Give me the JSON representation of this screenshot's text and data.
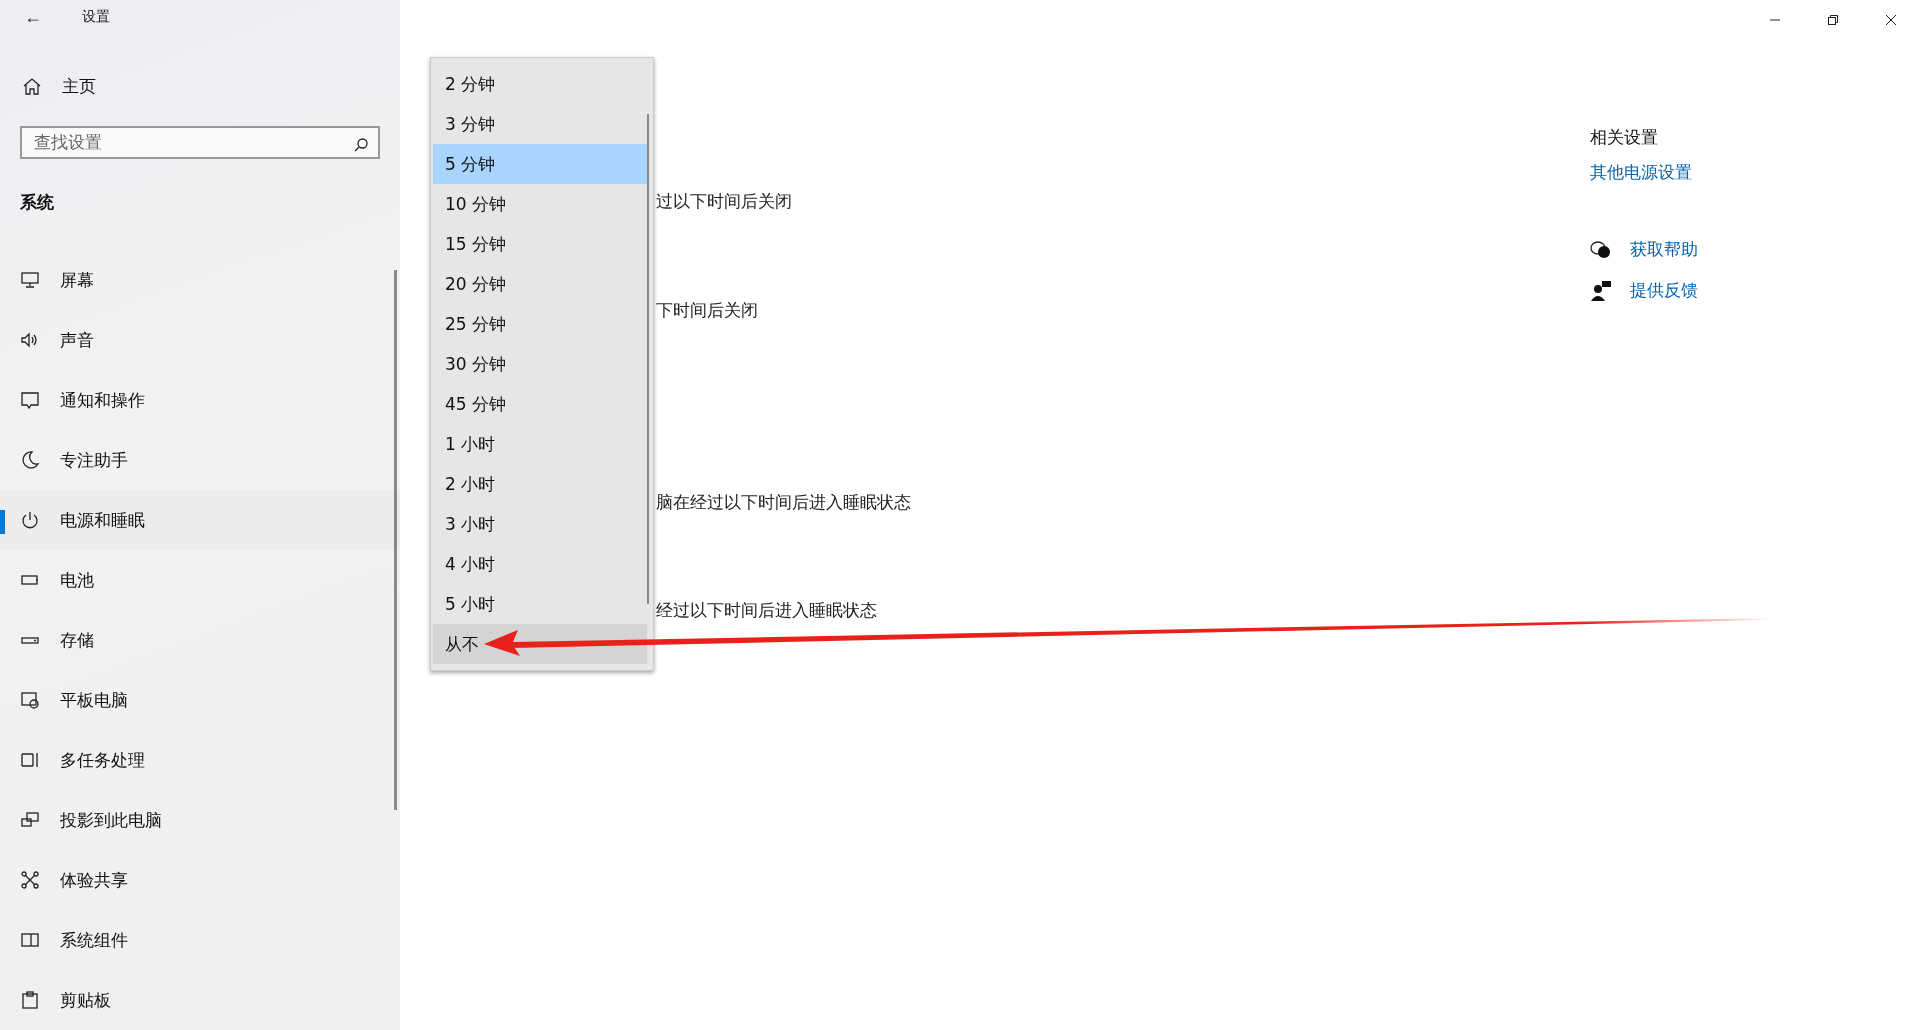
{
  "window": {
    "title": "设置",
    "back": "←"
  },
  "sidebar": {
    "home": "主页",
    "search": {
      "placeholder": "查找设置"
    },
    "section": "系统",
    "items": [
      {
        "label": "屏幕",
        "selected": false
      },
      {
        "label": "声音",
        "selected": false
      },
      {
        "label": "通知和操作",
        "selected": false
      },
      {
        "label": "专注助手",
        "selected": false
      },
      {
        "label": "电源和睡眠",
        "selected": true
      },
      {
        "label": "电池",
        "selected": false
      },
      {
        "label": "存储",
        "selected": false
      },
      {
        "label": "平板电脑",
        "selected": false
      },
      {
        "label": "多任务处理",
        "selected": false
      },
      {
        "label": "投影到此电脑",
        "selected": false
      },
      {
        "label": "体验共享",
        "selected": false
      },
      {
        "label": "系统组件",
        "selected": false
      },
      {
        "label": "剪贴板",
        "selected": false
      }
    ]
  },
  "main": {
    "lines": [
      {
        "text": "过以下时间后关闭"
      },
      {
        "text": "下时间后关闭"
      },
      {
        "text": "脑在经过以下时间后进入睡眠状态"
      },
      {
        "text": "经过以下时间后进入睡眠状态"
      }
    ]
  },
  "dropdown": {
    "options": [
      {
        "label": "2 分钟",
        "selected": false,
        "hovered": false
      },
      {
        "label": "3 分钟",
        "selected": false,
        "hovered": false
      },
      {
        "label": "5 分钟",
        "selected": true,
        "hovered": false
      },
      {
        "label": "10 分钟",
        "selected": false,
        "hovered": false
      },
      {
        "label": "15 分钟",
        "selected": false,
        "hovered": false
      },
      {
        "label": "20 分钟",
        "selected": false,
        "hovered": false
      },
      {
        "label": "25 分钟",
        "selected": false,
        "hovered": false
      },
      {
        "label": "30 分钟",
        "selected": false,
        "hovered": false
      },
      {
        "label": "45 分钟",
        "selected": false,
        "hovered": false
      },
      {
        "label": "1 小时",
        "selected": false,
        "hovered": false
      },
      {
        "label": "2 小时",
        "selected": false,
        "hovered": false
      },
      {
        "label": "3 小时",
        "selected": false,
        "hovered": false
      },
      {
        "label": "4 小时",
        "selected": false,
        "hovered": false
      },
      {
        "label": "5 小时",
        "selected": false,
        "hovered": false
      },
      {
        "label": "从不",
        "selected": false,
        "hovered": true
      }
    ]
  },
  "related": {
    "title": "相关设置",
    "link": "其他电源设置",
    "help": [
      {
        "label": "获取帮助"
      },
      {
        "label": "提供反馈"
      }
    ]
  }
}
